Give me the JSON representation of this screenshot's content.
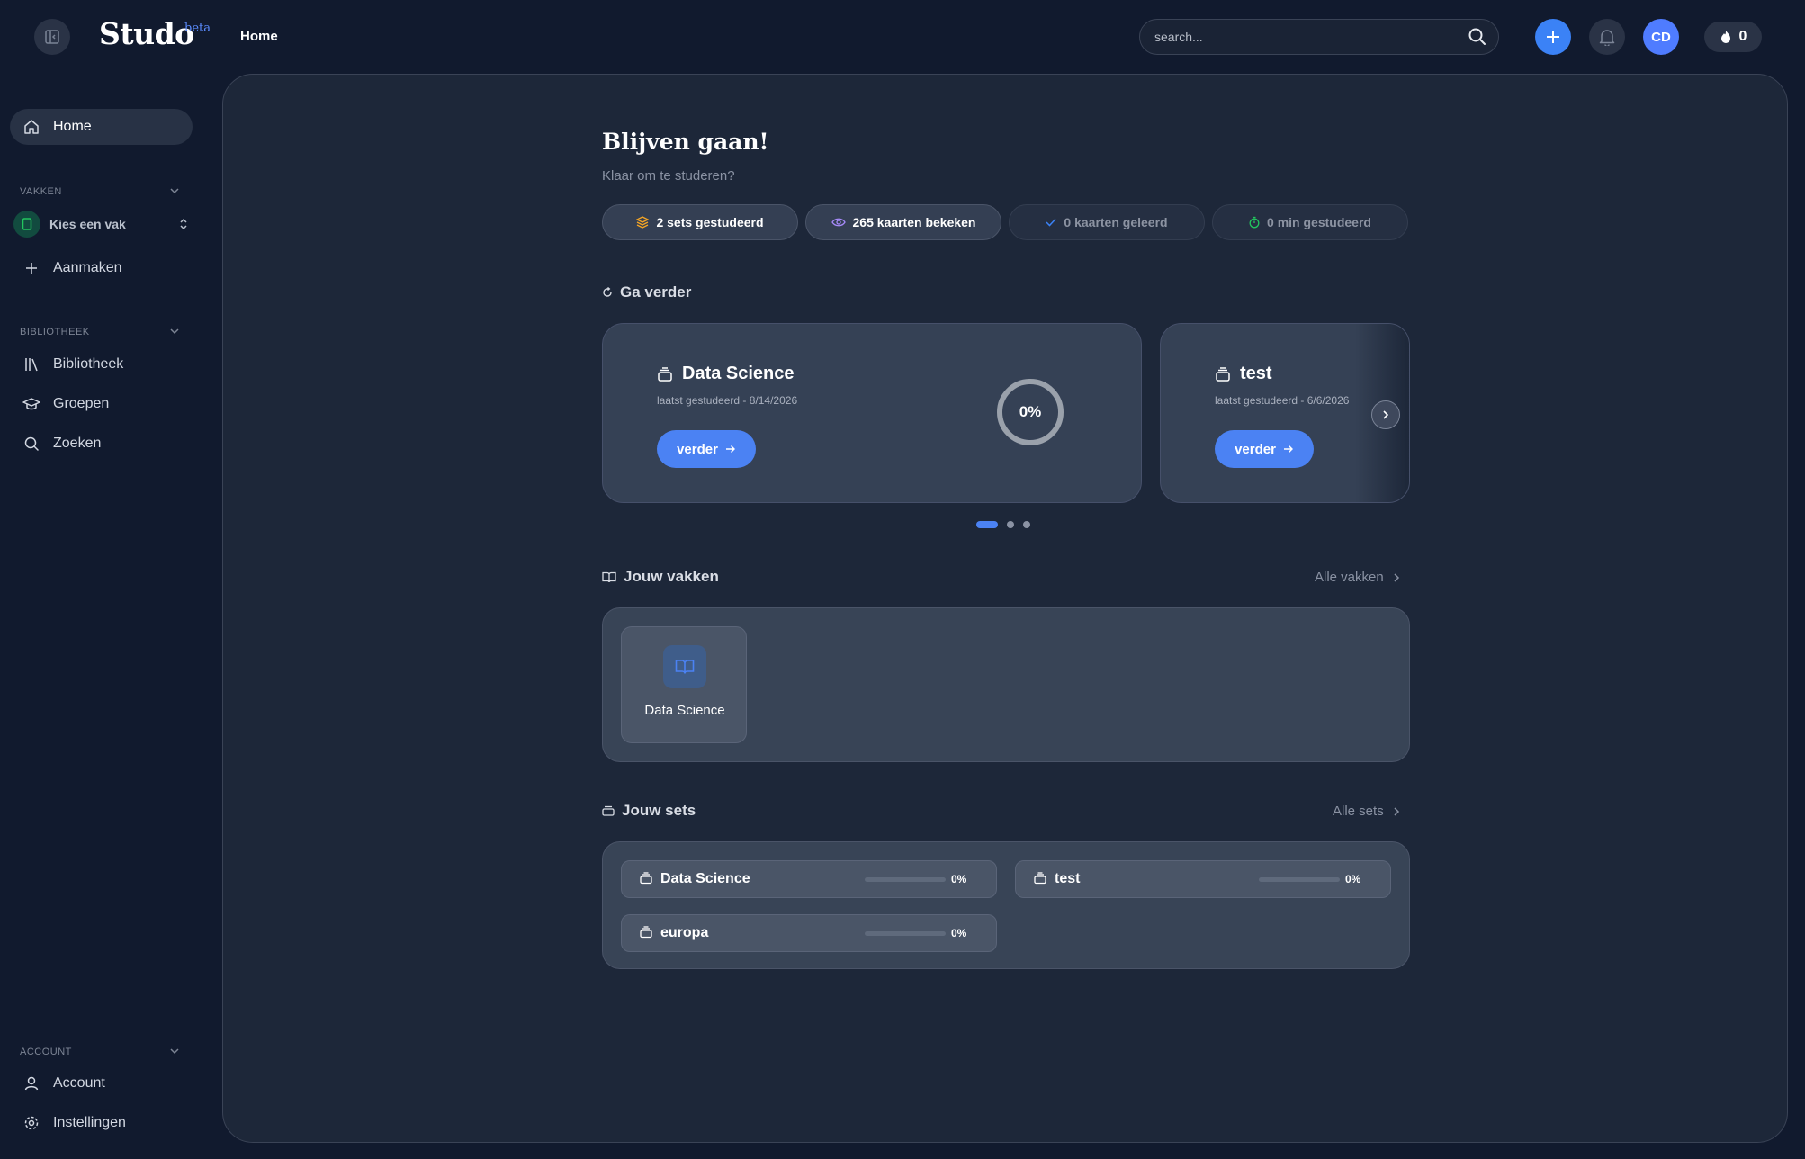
{
  "app": {
    "logo": "Studo",
    "beta": "beta",
    "breadcrumb": "Home"
  },
  "header": {
    "search_placeholder": "search...",
    "avatar_initials": "CD",
    "streak_count": "0"
  },
  "sidebar": {
    "home": "Home",
    "section_vakken": "VAKKEN",
    "vak_select": "Kies een vak",
    "create": "Aanmaken",
    "section_library": "BIBLIOTHEEK",
    "library_items": [
      "Bibliotheek",
      "Groepen",
      "Zoeken"
    ],
    "section_account": "ACCOUNT",
    "account_items": [
      "Account",
      "Instellingen"
    ]
  },
  "main": {
    "title": "Blijven gaan!",
    "subtitle": "Klaar om te studeren?",
    "stats": [
      {
        "label": "2 sets gestudeerd",
        "icon": "layers-icon",
        "color": "#f5a524"
      },
      {
        "label": "265 kaarten bekeken",
        "icon": "eye-icon",
        "color": "#a78bfa"
      },
      {
        "label": "0 kaarten geleerd",
        "icon": "check-icon",
        "color": "#3b82f6"
      },
      {
        "label": "0 min gestudeerd",
        "icon": "timer-icon",
        "color": "#22c55e"
      }
    ],
    "continue_heading": "Ga verder",
    "continue_cards": [
      {
        "title": "Data Science",
        "subtitle": "laatst gestudeerd - 8/14/2026",
        "button": "verder",
        "progress": "0%"
      },
      {
        "title": "test",
        "subtitle": "laatst gestudeerd - 6/6/2026",
        "button": "verder"
      }
    ],
    "carousel_active": 0,
    "vakken_heading": "Jouw vakken",
    "vakken_link": "Alle vakken",
    "vakken": [
      {
        "name": "Data Science"
      }
    ],
    "sets_heading": "Jouw sets",
    "sets_link": "Alle sets",
    "sets": [
      {
        "name": "Data Science",
        "progress": "0%",
        "fraction": 0
      },
      {
        "name": "test",
        "progress": "0%",
        "fraction": 0
      },
      {
        "name": "europa",
        "progress": "0%",
        "fraction": 0
      }
    ]
  }
}
